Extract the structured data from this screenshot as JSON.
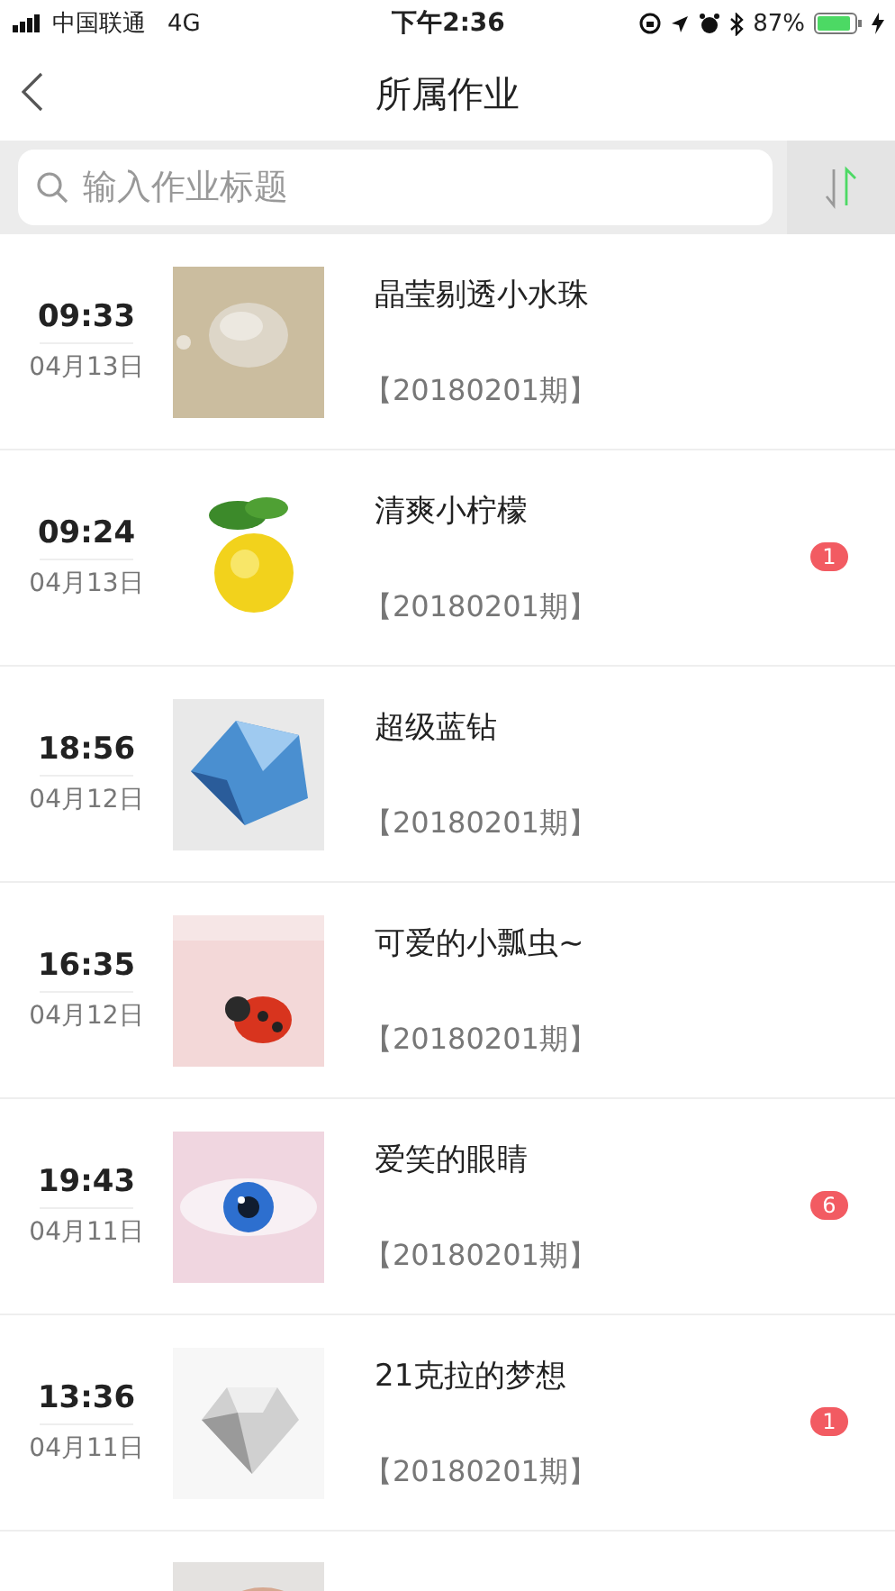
{
  "status_bar": {
    "carrier": "中国联通",
    "network": "4G",
    "time": "下午2:36",
    "battery_percent": "87%"
  },
  "nav_bar": {
    "title": "所属作业"
  },
  "search": {
    "placeholder": "输入作业标题"
  },
  "items": [
    {
      "time": "09:33",
      "date": "04月13日",
      "title": "晶莹剔透小水珠",
      "issue": "【20180201期】"
    },
    {
      "time": "09:24",
      "date": "04月13日",
      "title": "清爽小柠檬",
      "issue": "【20180201期】",
      "badge": "1"
    },
    {
      "time": "18:56",
      "date": "04月12日",
      "title": "超级蓝钻",
      "issue": "【20180201期】"
    },
    {
      "time": "16:35",
      "date": "04月12日",
      "title": "可爱的小瓢虫~",
      "issue": "【20180201期】"
    },
    {
      "time": "19:43",
      "date": "04月11日",
      "title": "爱笑的眼睛",
      "issue": "【20180201期】",
      "badge": "6"
    },
    {
      "time": "13:36",
      "date": "04月11日",
      "title": "21克拉的梦想",
      "issue": "【20180201期】",
      "badge": "1"
    }
  ]
}
